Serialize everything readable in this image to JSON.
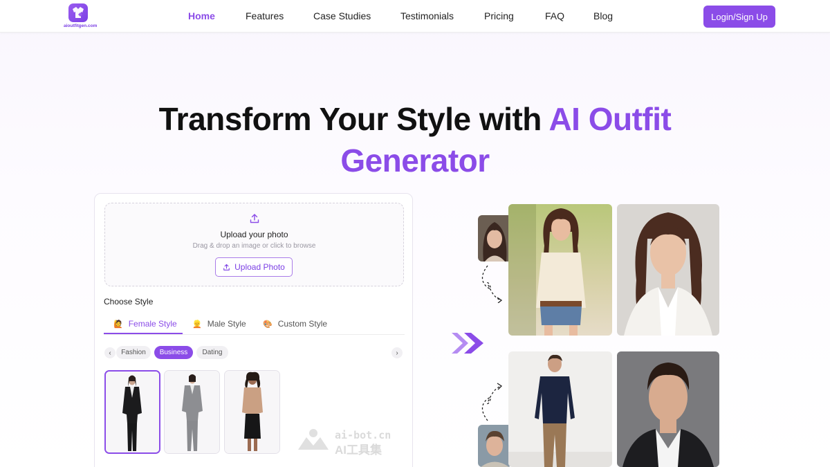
{
  "nav": {
    "logo_text": "aioutfitgen.com",
    "links": [
      "Home",
      "Features",
      "Case Studies",
      "Testimonials",
      "Pricing",
      "FAQ",
      "Blog"
    ],
    "active": "Home",
    "login_label": "Login/Sign Up"
  },
  "hero": {
    "title_part1": "Transform Your Style with ",
    "title_accent1": "AI Outfit",
    "title_accent2": "Generator"
  },
  "upload": {
    "title": "Upload your photo",
    "subtitle": "Drag & drop an image or click to browse",
    "button_label": "Upload Photo"
  },
  "style": {
    "heading": "Choose Style",
    "tabs": [
      {
        "label": "Female Style",
        "emoji": "🙋"
      },
      {
        "label": "Male Style",
        "emoji": "👱"
      },
      {
        "label": "Custom Style",
        "emoji": "🎨"
      }
    ],
    "active_tab": "Female Style",
    "categories": [
      "Fashion",
      "Business",
      "Dating"
    ],
    "active_category": "Business",
    "prev_arrow": "‹",
    "next_arrow": "›"
  },
  "watermark": {
    "line1": "ai-bot.cn",
    "line2": "AI工具集"
  },
  "colors": {
    "accent": "#8b4ce8",
    "text": "#111111"
  }
}
